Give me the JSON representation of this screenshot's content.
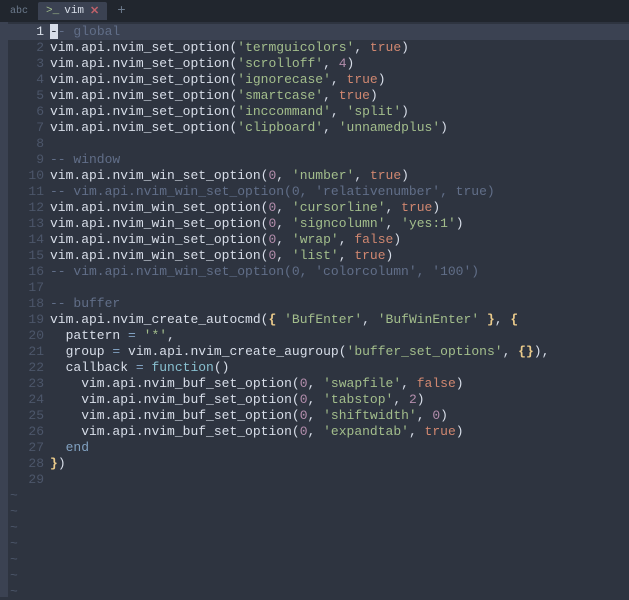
{
  "tabbar": {
    "leading": "abc",
    "tab_icon": ">_",
    "tab_label": "vim",
    "tab_close": "✕",
    "plus": "+"
  },
  "gutter_tilde": "~",
  "lines": [
    {
      "n": 1,
      "current": true,
      "tokens": [
        {
          "t": "-",
          "cls": "cursor"
        },
        {
          "t": "- global",
          "cls": "tk-comment"
        }
      ]
    },
    {
      "n": 2,
      "tokens": [
        {
          "t": "vim",
          "cls": "tk-ident"
        },
        {
          "t": ".",
          "cls": "tk-punct"
        },
        {
          "t": "api",
          "cls": "tk-ident"
        },
        {
          "t": ".",
          "cls": "tk-punct"
        },
        {
          "t": "nvim_set_option",
          "cls": "tk-ident"
        },
        {
          "t": "(",
          "cls": "tk-punct"
        },
        {
          "t": "'termguicolors'",
          "cls": "tk-string"
        },
        {
          "t": ", ",
          "cls": "tk-punct"
        },
        {
          "t": "true",
          "cls": "tk-bool"
        },
        {
          "t": ")",
          "cls": "tk-punct"
        }
      ]
    },
    {
      "n": 3,
      "tokens": [
        {
          "t": "vim",
          "cls": "tk-ident"
        },
        {
          "t": ".",
          "cls": "tk-punct"
        },
        {
          "t": "api",
          "cls": "tk-ident"
        },
        {
          "t": ".",
          "cls": "tk-punct"
        },
        {
          "t": "nvim_set_option",
          "cls": "tk-ident"
        },
        {
          "t": "(",
          "cls": "tk-punct"
        },
        {
          "t": "'scrolloff'",
          "cls": "tk-string"
        },
        {
          "t": ", ",
          "cls": "tk-punct"
        },
        {
          "t": "4",
          "cls": "tk-number"
        },
        {
          "t": ")",
          "cls": "tk-punct"
        }
      ]
    },
    {
      "n": 4,
      "tokens": [
        {
          "t": "vim",
          "cls": "tk-ident"
        },
        {
          "t": ".",
          "cls": "tk-punct"
        },
        {
          "t": "api",
          "cls": "tk-ident"
        },
        {
          "t": ".",
          "cls": "tk-punct"
        },
        {
          "t": "nvim_set_option",
          "cls": "tk-ident"
        },
        {
          "t": "(",
          "cls": "tk-punct"
        },
        {
          "t": "'ignorecase'",
          "cls": "tk-string"
        },
        {
          "t": ", ",
          "cls": "tk-punct"
        },
        {
          "t": "true",
          "cls": "tk-bool"
        },
        {
          "t": ")",
          "cls": "tk-punct"
        }
      ]
    },
    {
      "n": 5,
      "tokens": [
        {
          "t": "vim",
          "cls": "tk-ident"
        },
        {
          "t": ".",
          "cls": "tk-punct"
        },
        {
          "t": "api",
          "cls": "tk-ident"
        },
        {
          "t": ".",
          "cls": "tk-punct"
        },
        {
          "t": "nvim_set_option",
          "cls": "tk-ident"
        },
        {
          "t": "(",
          "cls": "tk-punct"
        },
        {
          "t": "'smartcase'",
          "cls": "tk-string"
        },
        {
          "t": ", ",
          "cls": "tk-punct"
        },
        {
          "t": "true",
          "cls": "tk-bool"
        },
        {
          "t": ")",
          "cls": "tk-punct"
        }
      ]
    },
    {
      "n": 6,
      "tokens": [
        {
          "t": "vim",
          "cls": "tk-ident"
        },
        {
          "t": ".",
          "cls": "tk-punct"
        },
        {
          "t": "api",
          "cls": "tk-ident"
        },
        {
          "t": ".",
          "cls": "tk-punct"
        },
        {
          "t": "nvim_set_option",
          "cls": "tk-ident"
        },
        {
          "t": "(",
          "cls": "tk-punct"
        },
        {
          "t": "'inccommand'",
          "cls": "tk-string"
        },
        {
          "t": ", ",
          "cls": "tk-punct"
        },
        {
          "t": "'split'",
          "cls": "tk-string"
        },
        {
          "t": ")",
          "cls": "tk-punct"
        }
      ]
    },
    {
      "n": 7,
      "tokens": [
        {
          "t": "vim",
          "cls": "tk-ident"
        },
        {
          "t": ".",
          "cls": "tk-punct"
        },
        {
          "t": "api",
          "cls": "tk-ident"
        },
        {
          "t": ".",
          "cls": "tk-punct"
        },
        {
          "t": "nvim_set_option",
          "cls": "tk-ident"
        },
        {
          "t": "(",
          "cls": "tk-punct"
        },
        {
          "t": "'clipboard'",
          "cls": "tk-string"
        },
        {
          "t": ", ",
          "cls": "tk-punct"
        },
        {
          "t": "'unnamedplus'",
          "cls": "tk-string"
        },
        {
          "t": ")",
          "cls": "tk-punct"
        }
      ]
    },
    {
      "n": 8,
      "tokens": []
    },
    {
      "n": 9,
      "tokens": [
        {
          "t": "-- window",
          "cls": "tk-comment"
        }
      ]
    },
    {
      "n": 10,
      "tokens": [
        {
          "t": "vim",
          "cls": "tk-ident"
        },
        {
          "t": ".",
          "cls": "tk-punct"
        },
        {
          "t": "api",
          "cls": "tk-ident"
        },
        {
          "t": ".",
          "cls": "tk-punct"
        },
        {
          "t": "nvim_win_set_option",
          "cls": "tk-ident"
        },
        {
          "t": "(",
          "cls": "tk-punct"
        },
        {
          "t": "0",
          "cls": "tk-number"
        },
        {
          "t": ", ",
          "cls": "tk-punct"
        },
        {
          "t": "'number'",
          "cls": "tk-string"
        },
        {
          "t": ", ",
          "cls": "tk-punct"
        },
        {
          "t": "true",
          "cls": "tk-bool"
        },
        {
          "t": ")",
          "cls": "tk-punct"
        }
      ]
    },
    {
      "n": 11,
      "tokens": [
        {
          "t": "-- vim.api.nvim_win_set_option(0, 'relativenumber', true)",
          "cls": "tk-comment"
        }
      ]
    },
    {
      "n": 12,
      "tokens": [
        {
          "t": "vim",
          "cls": "tk-ident"
        },
        {
          "t": ".",
          "cls": "tk-punct"
        },
        {
          "t": "api",
          "cls": "tk-ident"
        },
        {
          "t": ".",
          "cls": "tk-punct"
        },
        {
          "t": "nvim_win_set_option",
          "cls": "tk-ident"
        },
        {
          "t": "(",
          "cls": "tk-punct"
        },
        {
          "t": "0",
          "cls": "tk-number"
        },
        {
          "t": ", ",
          "cls": "tk-punct"
        },
        {
          "t": "'cursorline'",
          "cls": "tk-string"
        },
        {
          "t": ", ",
          "cls": "tk-punct"
        },
        {
          "t": "true",
          "cls": "tk-bool"
        },
        {
          "t": ")",
          "cls": "tk-punct"
        }
      ]
    },
    {
      "n": 13,
      "tokens": [
        {
          "t": "vim",
          "cls": "tk-ident"
        },
        {
          "t": ".",
          "cls": "tk-punct"
        },
        {
          "t": "api",
          "cls": "tk-ident"
        },
        {
          "t": ".",
          "cls": "tk-punct"
        },
        {
          "t": "nvim_win_set_option",
          "cls": "tk-ident"
        },
        {
          "t": "(",
          "cls": "tk-punct"
        },
        {
          "t": "0",
          "cls": "tk-number"
        },
        {
          "t": ", ",
          "cls": "tk-punct"
        },
        {
          "t": "'signcolumn'",
          "cls": "tk-string"
        },
        {
          "t": ", ",
          "cls": "tk-punct"
        },
        {
          "t": "'yes:1'",
          "cls": "tk-string"
        },
        {
          "t": ")",
          "cls": "tk-punct"
        }
      ]
    },
    {
      "n": 14,
      "tokens": [
        {
          "t": "vim",
          "cls": "tk-ident"
        },
        {
          "t": ".",
          "cls": "tk-punct"
        },
        {
          "t": "api",
          "cls": "tk-ident"
        },
        {
          "t": ".",
          "cls": "tk-punct"
        },
        {
          "t": "nvim_win_set_option",
          "cls": "tk-ident"
        },
        {
          "t": "(",
          "cls": "tk-punct"
        },
        {
          "t": "0",
          "cls": "tk-number"
        },
        {
          "t": ", ",
          "cls": "tk-punct"
        },
        {
          "t": "'wrap'",
          "cls": "tk-string"
        },
        {
          "t": ", ",
          "cls": "tk-punct"
        },
        {
          "t": "false",
          "cls": "tk-bool"
        },
        {
          "t": ")",
          "cls": "tk-punct"
        }
      ]
    },
    {
      "n": 15,
      "tokens": [
        {
          "t": "vim",
          "cls": "tk-ident"
        },
        {
          "t": ".",
          "cls": "tk-punct"
        },
        {
          "t": "api",
          "cls": "tk-ident"
        },
        {
          "t": ".",
          "cls": "tk-punct"
        },
        {
          "t": "nvim_win_set_option",
          "cls": "tk-ident"
        },
        {
          "t": "(",
          "cls": "tk-punct"
        },
        {
          "t": "0",
          "cls": "tk-number"
        },
        {
          "t": ", ",
          "cls": "tk-punct"
        },
        {
          "t": "'list'",
          "cls": "tk-string"
        },
        {
          "t": ", ",
          "cls": "tk-punct"
        },
        {
          "t": "true",
          "cls": "tk-bool"
        },
        {
          "t": ")",
          "cls": "tk-punct"
        }
      ]
    },
    {
      "n": 16,
      "tokens": [
        {
          "t": "-- vim.api.nvim_win_set_option(0, 'colorcolumn', '100')",
          "cls": "tk-comment"
        }
      ]
    },
    {
      "n": 17,
      "tokens": []
    },
    {
      "n": 18,
      "tokens": [
        {
          "t": "-- buffer",
          "cls": "tk-comment"
        }
      ]
    },
    {
      "n": 19,
      "tokens": [
        {
          "t": "vim",
          "cls": "tk-ident"
        },
        {
          "t": ".",
          "cls": "tk-punct"
        },
        {
          "t": "api",
          "cls": "tk-ident"
        },
        {
          "t": ".",
          "cls": "tk-punct"
        },
        {
          "t": "nvim_create_autocmd",
          "cls": "tk-ident"
        },
        {
          "t": "(",
          "cls": "tk-punct"
        },
        {
          "t": "{",
          "cls": "tk-brace-y"
        },
        {
          "t": " ",
          "cls": "tk-punct"
        },
        {
          "t": "'BufEnter'",
          "cls": "tk-string"
        },
        {
          "t": ", ",
          "cls": "tk-punct"
        },
        {
          "t": "'BufWinEnter'",
          "cls": "tk-string"
        },
        {
          "t": " ",
          "cls": "tk-punct"
        },
        {
          "t": "}",
          "cls": "tk-brace-y"
        },
        {
          "t": ", ",
          "cls": "tk-punct"
        },
        {
          "t": "{",
          "cls": "tk-brace-y"
        }
      ]
    },
    {
      "n": 20,
      "tokens": [
        {
          "t": "  pattern ",
          "cls": "tk-ident"
        },
        {
          "t": "=",
          "cls": "tk-keyword"
        },
        {
          "t": " ",
          "cls": "tk-punct"
        },
        {
          "t": "'*'",
          "cls": "tk-string"
        },
        {
          "t": ",",
          "cls": "tk-punct"
        }
      ]
    },
    {
      "n": 21,
      "tokens": [
        {
          "t": "  group ",
          "cls": "tk-ident"
        },
        {
          "t": "=",
          "cls": "tk-keyword"
        },
        {
          "t": " vim",
          "cls": "tk-ident"
        },
        {
          "t": ".",
          "cls": "tk-punct"
        },
        {
          "t": "api",
          "cls": "tk-ident"
        },
        {
          "t": ".",
          "cls": "tk-punct"
        },
        {
          "t": "nvim_create_augroup",
          "cls": "tk-ident"
        },
        {
          "t": "(",
          "cls": "tk-punct"
        },
        {
          "t": "'buffer_set_options'",
          "cls": "tk-string"
        },
        {
          "t": ", ",
          "cls": "tk-punct"
        },
        {
          "t": "{}",
          "cls": "tk-brace-y"
        },
        {
          "t": "),",
          "cls": "tk-punct"
        }
      ]
    },
    {
      "n": 22,
      "tokens": [
        {
          "t": "  callback ",
          "cls": "tk-ident"
        },
        {
          "t": "=",
          "cls": "tk-keyword"
        },
        {
          "t": " ",
          "cls": "tk-punct"
        },
        {
          "t": "function",
          "cls": "tk-func"
        },
        {
          "t": "()",
          "cls": "tk-punct"
        }
      ]
    },
    {
      "n": 23,
      "tokens": [
        {
          "t": "    vim",
          "cls": "tk-ident"
        },
        {
          "t": ".",
          "cls": "tk-punct"
        },
        {
          "t": "api",
          "cls": "tk-ident"
        },
        {
          "t": ".",
          "cls": "tk-punct"
        },
        {
          "t": "nvim_buf_set_option",
          "cls": "tk-ident"
        },
        {
          "t": "(",
          "cls": "tk-punct"
        },
        {
          "t": "0",
          "cls": "tk-number"
        },
        {
          "t": ", ",
          "cls": "tk-punct"
        },
        {
          "t": "'swapfile'",
          "cls": "tk-string"
        },
        {
          "t": ", ",
          "cls": "tk-punct"
        },
        {
          "t": "false",
          "cls": "tk-bool"
        },
        {
          "t": ")",
          "cls": "tk-punct"
        }
      ]
    },
    {
      "n": 24,
      "tokens": [
        {
          "t": "    vim",
          "cls": "tk-ident"
        },
        {
          "t": ".",
          "cls": "tk-punct"
        },
        {
          "t": "api",
          "cls": "tk-ident"
        },
        {
          "t": ".",
          "cls": "tk-punct"
        },
        {
          "t": "nvim_buf_set_option",
          "cls": "tk-ident"
        },
        {
          "t": "(",
          "cls": "tk-punct"
        },
        {
          "t": "0",
          "cls": "tk-number"
        },
        {
          "t": ", ",
          "cls": "tk-punct"
        },
        {
          "t": "'tabstop'",
          "cls": "tk-string"
        },
        {
          "t": ", ",
          "cls": "tk-punct"
        },
        {
          "t": "2",
          "cls": "tk-number"
        },
        {
          "t": ")",
          "cls": "tk-punct"
        }
      ]
    },
    {
      "n": 25,
      "tokens": [
        {
          "t": "    vim",
          "cls": "tk-ident"
        },
        {
          "t": ".",
          "cls": "tk-punct"
        },
        {
          "t": "api",
          "cls": "tk-ident"
        },
        {
          "t": ".",
          "cls": "tk-punct"
        },
        {
          "t": "nvim_buf_set_option",
          "cls": "tk-ident"
        },
        {
          "t": "(",
          "cls": "tk-punct"
        },
        {
          "t": "0",
          "cls": "tk-number"
        },
        {
          "t": ", ",
          "cls": "tk-punct"
        },
        {
          "t": "'shiftwidth'",
          "cls": "tk-string"
        },
        {
          "t": ", ",
          "cls": "tk-punct"
        },
        {
          "t": "0",
          "cls": "tk-number"
        },
        {
          "t": ")",
          "cls": "tk-punct"
        }
      ]
    },
    {
      "n": 26,
      "tokens": [
        {
          "t": "    vim",
          "cls": "tk-ident"
        },
        {
          "t": ".",
          "cls": "tk-punct"
        },
        {
          "t": "api",
          "cls": "tk-ident"
        },
        {
          "t": ".",
          "cls": "tk-punct"
        },
        {
          "t": "nvim_buf_set_option",
          "cls": "tk-ident"
        },
        {
          "t": "(",
          "cls": "tk-punct"
        },
        {
          "t": "0",
          "cls": "tk-number"
        },
        {
          "t": ", ",
          "cls": "tk-punct"
        },
        {
          "t": "'expandtab'",
          "cls": "tk-string"
        },
        {
          "t": ", ",
          "cls": "tk-punct"
        },
        {
          "t": "true",
          "cls": "tk-bool"
        },
        {
          "t": ")",
          "cls": "tk-punct"
        }
      ]
    },
    {
      "n": 27,
      "tokens": [
        {
          "t": "  ",
          "cls": "tk-punct"
        },
        {
          "t": "end",
          "cls": "tk-keyword"
        }
      ]
    },
    {
      "n": 28,
      "tokens": [
        {
          "t": "}",
          "cls": "tk-brace-y"
        },
        {
          "t": ")",
          "cls": "tk-punct"
        }
      ]
    },
    {
      "n": 29,
      "tokens": []
    }
  ],
  "tilde_rows": 7
}
